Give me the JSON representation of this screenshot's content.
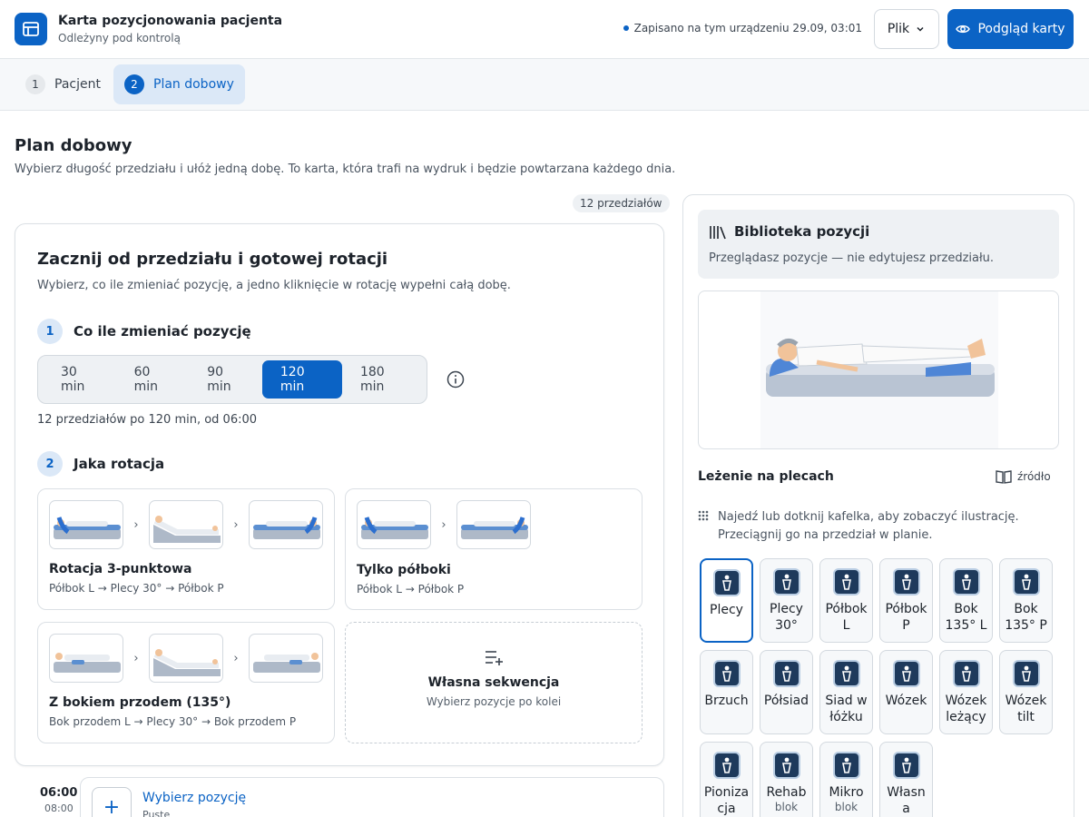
{
  "header": {
    "title": "Karta pozycjonowania pacjenta",
    "subtitle": "Odleżyny pod kontrolą",
    "saved": "Zapisano na tym urządzeniu 29.09, 03:01",
    "file_label": "Plik",
    "preview_label": "Podgląd karty"
  },
  "tabs": [
    {
      "num": "1",
      "label": "Pacjent"
    },
    {
      "num": "2",
      "label": "Plan dobowy"
    }
  ],
  "page": {
    "title": "Plan dobowy",
    "description": "Wybierz długość przedziału i ułóż jedną dobę. To karta, która trafi na wydruk i będzie powtarzana każdego dnia.",
    "count_badge": "12 przedziałów"
  },
  "start_card": {
    "title": "Zacznij od przedziału i gotowej rotacji",
    "description": "Wybierz, co ile zmieniać pozycję, a jedno kliknięcie w rotację wypełni całą dobę.",
    "step1": {
      "num": "1",
      "label": "Co ile zmieniać pozycję"
    },
    "intervals": [
      "30 min",
      "60 min",
      "90 min",
      "120 min",
      "180 min"
    ],
    "selected_interval": "120 min",
    "interval_summary": "12 przedziałów po 120 min, od 06:00",
    "step2": {
      "num": "2",
      "label": "Jaka rotacja"
    },
    "rotations": [
      {
        "name": "Rotacja 3-punktowa",
        "sequence": "Półbok L → Plecy 30° → Półbok P"
      },
      {
        "name": "Tylko półboki",
        "sequence": "Półbok L → Półbok P"
      },
      {
        "name": "Z bokiem przodem (135°)",
        "sequence": "Bok przodem L → Plecy 30° → Bok przodem P"
      }
    ],
    "custom": {
      "name": "Własna sekwencja",
      "sub": "Wybierz pozycje po kolei"
    }
  },
  "timeline": {
    "start": "06:00",
    "end": "08:00",
    "slot_label": "Wybierz pozycję",
    "slot_status": "Puste"
  },
  "library": {
    "title": "Biblioteka pozycji",
    "description": "Przeglądasz pozycje — nie edytujesz przedziału.",
    "current_position": "Leżenie na plecach",
    "source_label": "źródło",
    "hint": "Najedź lub dotknij kafelka, aby zobaczyć ilustrację. Przeciągnij go na przedział w planie.",
    "positions": [
      {
        "l1": "Plecy",
        "l2": "",
        "sub": ""
      },
      {
        "l1": "Plecy",
        "l2": "30°",
        "sub": ""
      },
      {
        "l1": "Półbok",
        "l2": "L",
        "sub": ""
      },
      {
        "l1": "Półbok",
        "l2": "P",
        "sub": ""
      },
      {
        "l1": "Bok",
        "l2": "135° L",
        "sub": ""
      },
      {
        "l1": "Bok",
        "l2": "135° P",
        "sub": ""
      },
      {
        "l1": "Brzuch",
        "l2": "",
        "sub": ""
      },
      {
        "l1": "Półsiad",
        "l2": "",
        "sub": ""
      },
      {
        "l1": "Siad w",
        "l2": "łóżku",
        "sub": ""
      },
      {
        "l1": "Wózek",
        "l2": "",
        "sub": ""
      },
      {
        "l1": "Wózek",
        "l2": "leżący",
        "sub": ""
      },
      {
        "l1": "Wózek",
        "l2": "tilt",
        "sub": ""
      },
      {
        "l1": "Pioniza",
        "l2": "cja",
        "sub": ""
      },
      {
        "l1": "Rehab",
        "l2": "",
        "sub": "blok"
      },
      {
        "l1": "Mikro",
        "l2": "",
        "sub": "blok"
      },
      {
        "l1": "Własn",
        "l2": "a",
        "sub": ""
      }
    ]
  },
  "colors": {
    "accent": "#0b63c5",
    "tile_icon": "#1e3a5c"
  }
}
